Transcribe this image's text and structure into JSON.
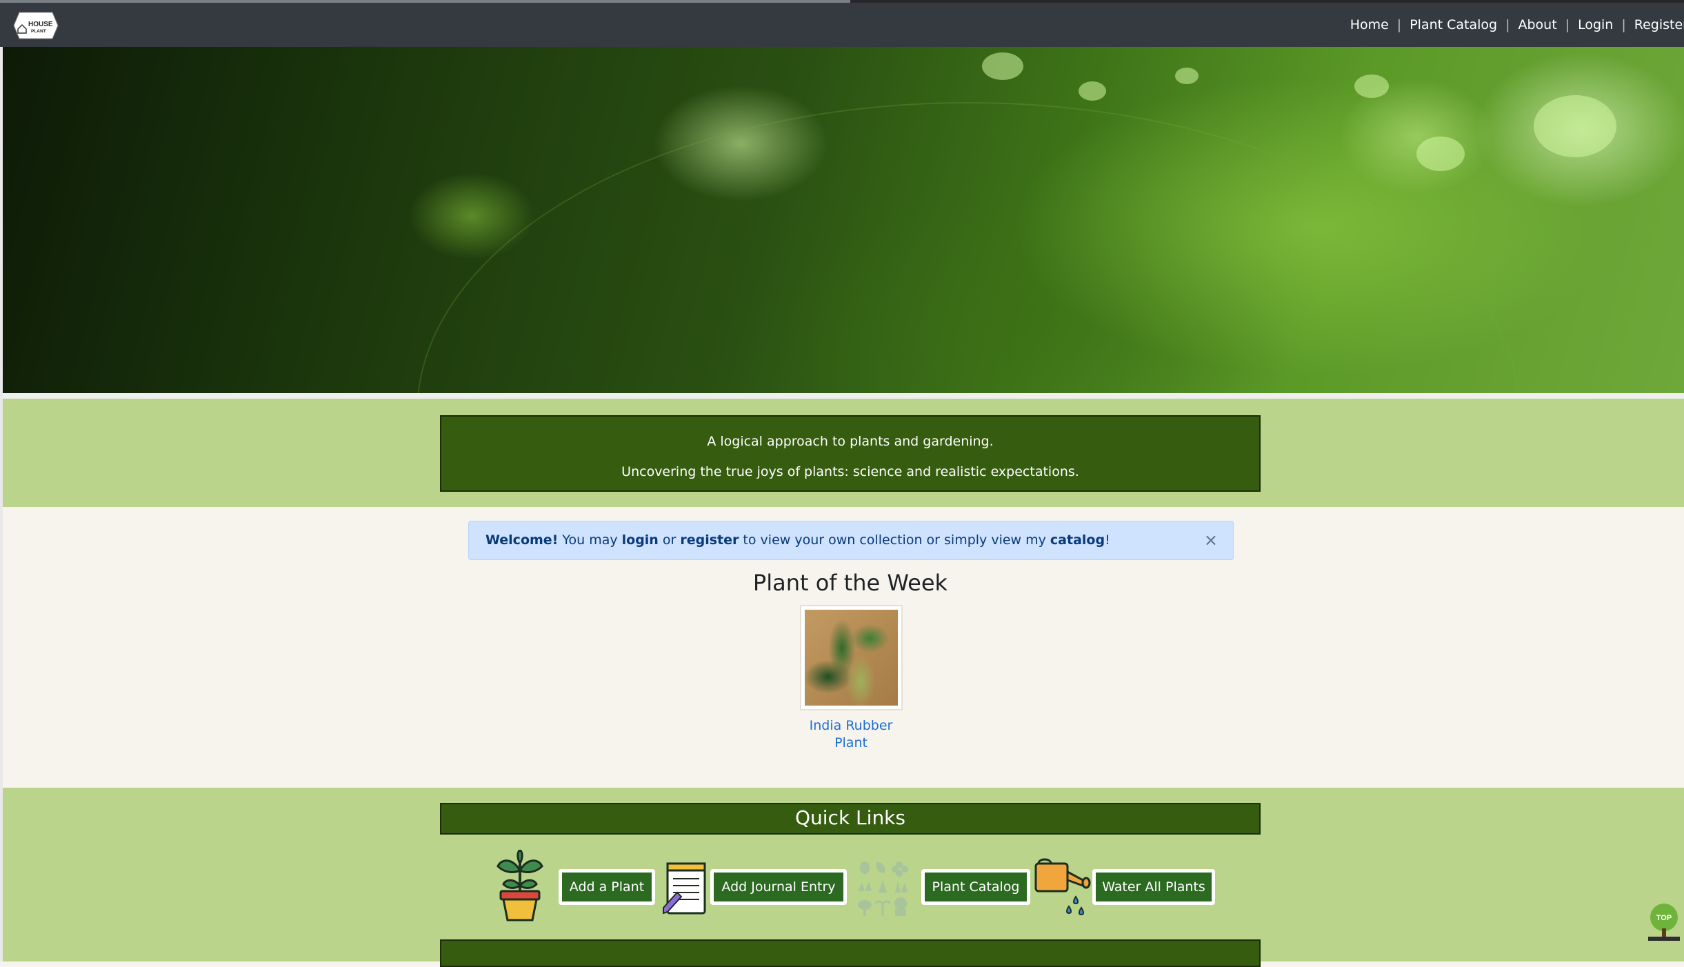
{
  "navbar": {
    "logo_text": "HOUSE PLANT",
    "links": [
      "Home",
      "Plant Catalog",
      "About",
      "Login",
      "Register"
    ]
  },
  "tagline": {
    "line1": "A logical approach to plants and gardening.",
    "line2": "Uncovering the true joys of plants: science and realistic expectations."
  },
  "alert": {
    "strong": "Welcome!",
    "t1": " You may ",
    "login": "login",
    "t2": " or ",
    "register": "register",
    "t3": " to view your own collection or simply view my ",
    "catalog": "catalog",
    "t4": "!",
    "close": "×"
  },
  "plant_of_week": {
    "title": "Plant of the Week",
    "name_line1": "India Rubber",
    "name_line2": "Plant"
  },
  "quick_links": {
    "title": "Quick Links",
    "buttons": [
      "Add a Plant",
      "Add Journal Entry",
      "Plant Catalog",
      "Water All Plants"
    ]
  },
  "top_button": "TOP",
  "colors": {
    "navbar": "#353a40",
    "green_band": "#bad48c",
    "dark_green_box": "#355c0f",
    "button_green": "#2b6a20",
    "link_blue": "#1a6fd6",
    "alert_bg": "#cfe2fe"
  }
}
